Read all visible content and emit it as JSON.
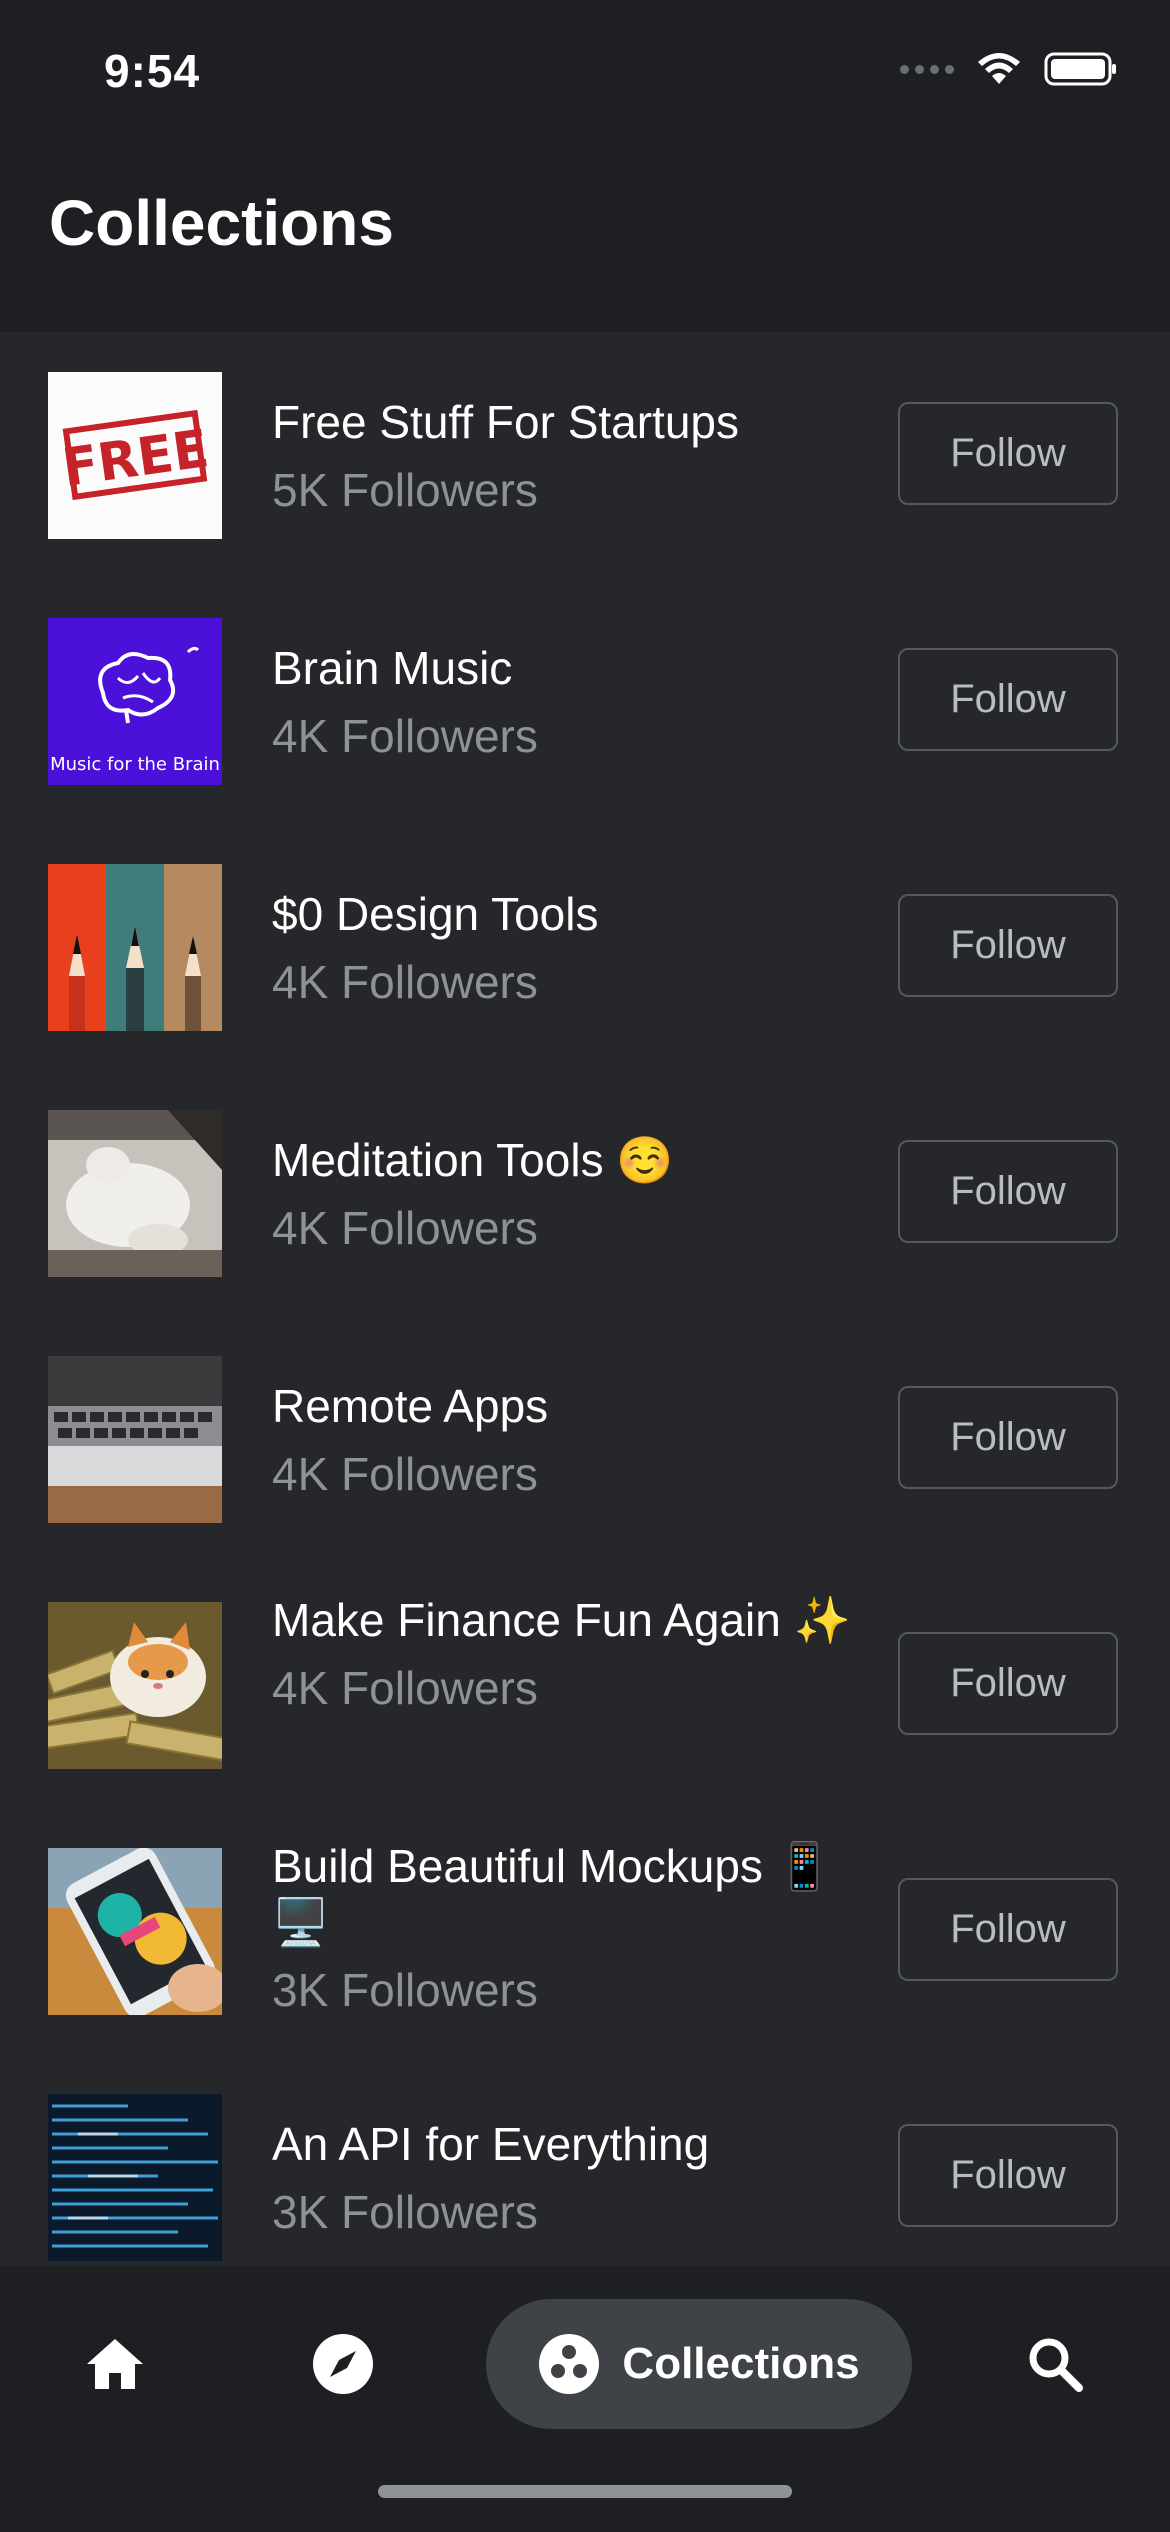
{
  "status": {
    "time": "9:54"
  },
  "header": {
    "title": "Collections"
  },
  "collections": [
    {
      "title": "Free Stuff For Startups",
      "followers": "5K Followers",
      "follow_label": "Follow",
      "thumb_text": "FREE"
    },
    {
      "title": "Brain Music",
      "followers": "4K Followers",
      "follow_label": "Follow",
      "thumb_text": "Music for the Brain"
    },
    {
      "title": "$0 Design Tools",
      "followers": "4K Followers",
      "follow_label": "Follow"
    },
    {
      "title": "Meditation Tools ☺️",
      "followers": "4K Followers",
      "follow_label": "Follow"
    },
    {
      "title": "Remote Apps",
      "followers": "4K Followers",
      "follow_label": "Follow"
    },
    {
      "title": "Make Finance Fun Again ✨",
      "followers": "4K Followers",
      "follow_label": "Follow"
    },
    {
      "title": "Build Beautiful Mockups 📱 🖥️",
      "followers": "3K Followers",
      "follow_label": "Follow"
    },
    {
      "title": "An API for Everything",
      "followers": "3K Followers",
      "follow_label": "Follow"
    }
  ],
  "tabbar": {
    "items": [
      {
        "name": "home",
        "icon": "home-icon"
      },
      {
        "name": "explore",
        "icon": "compass-icon"
      },
      {
        "name": "collections",
        "icon": "collections-icon",
        "label": "Collections",
        "active": true
      },
      {
        "name": "search",
        "icon": "search-icon"
      }
    ]
  },
  "colors": {
    "background": "#25272a",
    "header": "#1d1f22",
    "muted_text": "#8e9196",
    "button_border": "#55585c"
  }
}
